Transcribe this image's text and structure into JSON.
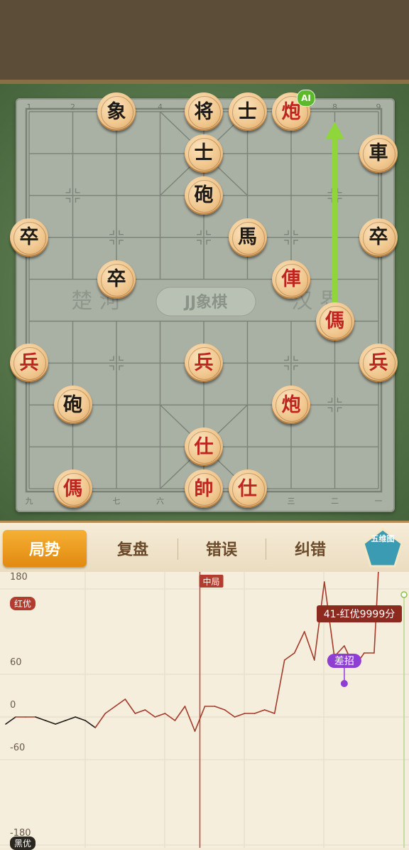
{
  "board": {
    "watermark_left": "楚 河",
    "watermark_logo": "JJ象棋",
    "watermark_right": "汉 界",
    "top_file_numbers": [
      "1",
      "2",
      "3",
      "4",
      "5",
      "6",
      "7",
      "8",
      "9"
    ],
    "bottom_file_numbers": [
      "九",
      "八",
      "七",
      "六",
      "五",
      "四",
      "三",
      "二",
      "一"
    ],
    "ai_badge": "AI",
    "move_arrow": {
      "from": [
        7,
        5
      ],
      "to": [
        7,
        0
      ],
      "color": "#8fd63a"
    },
    "pieces": [
      {
        "id": "black-elephant-1",
        "label": "象",
        "side": "black",
        "col": 2,
        "row": 0
      },
      {
        "id": "black-general",
        "label": "将",
        "side": "black",
        "col": 4,
        "row": 0
      },
      {
        "id": "black-advisor-1",
        "label": "士",
        "side": "black",
        "col": 5,
        "row": 0
      },
      {
        "id": "red-cannon-1",
        "label": "炮",
        "side": "red",
        "col": 6,
        "row": 0
      },
      {
        "id": "black-advisor-2",
        "label": "士",
        "side": "black",
        "col": 4,
        "row": 1
      },
      {
        "id": "black-chariot",
        "label": "車",
        "side": "black",
        "col": 8,
        "row": 1
      },
      {
        "id": "black-cannon-1",
        "label": "砲",
        "side": "black",
        "col": 4,
        "row": 2
      },
      {
        "id": "black-soldier-1",
        "label": "卒",
        "side": "black",
        "col": 0,
        "row": 3
      },
      {
        "id": "black-horse",
        "label": "馬",
        "side": "black",
        "col": 5,
        "row": 3
      },
      {
        "id": "black-soldier-2",
        "label": "卒",
        "side": "black",
        "col": 8,
        "row": 3
      },
      {
        "id": "black-soldier-3",
        "label": "卒",
        "side": "black",
        "col": 2,
        "row": 4
      },
      {
        "id": "red-elephant",
        "label": "俥",
        "side": "red",
        "col": 6,
        "row": 4
      },
      {
        "id": "red-horse-1",
        "label": "傌",
        "side": "red",
        "col": 7,
        "row": 5
      },
      {
        "id": "red-soldier-1",
        "label": "兵",
        "side": "red",
        "col": 0,
        "row": 6
      },
      {
        "id": "red-soldier-2",
        "label": "兵",
        "side": "red",
        "col": 4,
        "row": 6
      },
      {
        "id": "red-soldier-3",
        "label": "兵",
        "side": "red",
        "col": 8,
        "row": 6
      },
      {
        "id": "black-cannon-2",
        "label": "砲",
        "side": "black",
        "col": 1,
        "row": 7
      },
      {
        "id": "red-cannon-2",
        "label": "炮",
        "side": "red",
        "col": 6,
        "row": 7
      },
      {
        "id": "red-advisor-1",
        "label": "仕",
        "side": "red",
        "col": 4,
        "row": 8
      },
      {
        "id": "red-horse-2",
        "label": "傌",
        "side": "red",
        "col": 1,
        "row": 9
      },
      {
        "id": "red-king",
        "label": "帥",
        "side": "red",
        "col": 4,
        "row": 9
      },
      {
        "id": "red-advisor-2",
        "label": "仕",
        "side": "red",
        "col": 5,
        "row": 9
      }
    ]
  },
  "tabs": {
    "items": [
      {
        "label": "局势",
        "active": true
      },
      {
        "label": "复盘",
        "active": false
      },
      {
        "label": "错误",
        "active": false
      },
      {
        "label": "纠错",
        "active": false
      }
    ],
    "five_dim_label": "五维图"
  },
  "chart_data": {
    "type": "line",
    "ylabel_top": "红优",
    "ylabel_bottom": "黑优",
    "yticks": [
      180,
      60,
      0,
      -60,
      -180
    ],
    "ylim": [
      -260,
      360
    ],
    "xlim": [
      0,
      41
    ],
    "phase_marker": {
      "label": "中局",
      "x": 19.5
    },
    "annotation": {
      "label": "差招",
      "x": 34,
      "y": 85
    },
    "end_label": "41-红优9999分",
    "values": [
      -10,
      0,
      0,
      0,
      -5,
      -10,
      -5,
      0,
      -5,
      -15,
      5,
      15,
      25,
      5,
      10,
      0,
      5,
      -5,
      15,
      -20,
      15,
      15,
      10,
      0,
      5,
      5,
      10,
      5,
      80,
      90,
      120,
      80,
      190,
      85,
      100,
      70,
      90,
      90,
      360,
      360,
      360
    ],
    "colors": {
      "red_line": "#a33a2a",
      "black_line": "#1e1a16",
      "phase_line": "#c0463a",
      "annotation": "#8e3ed1",
      "end": "#8d2a20"
    }
  }
}
